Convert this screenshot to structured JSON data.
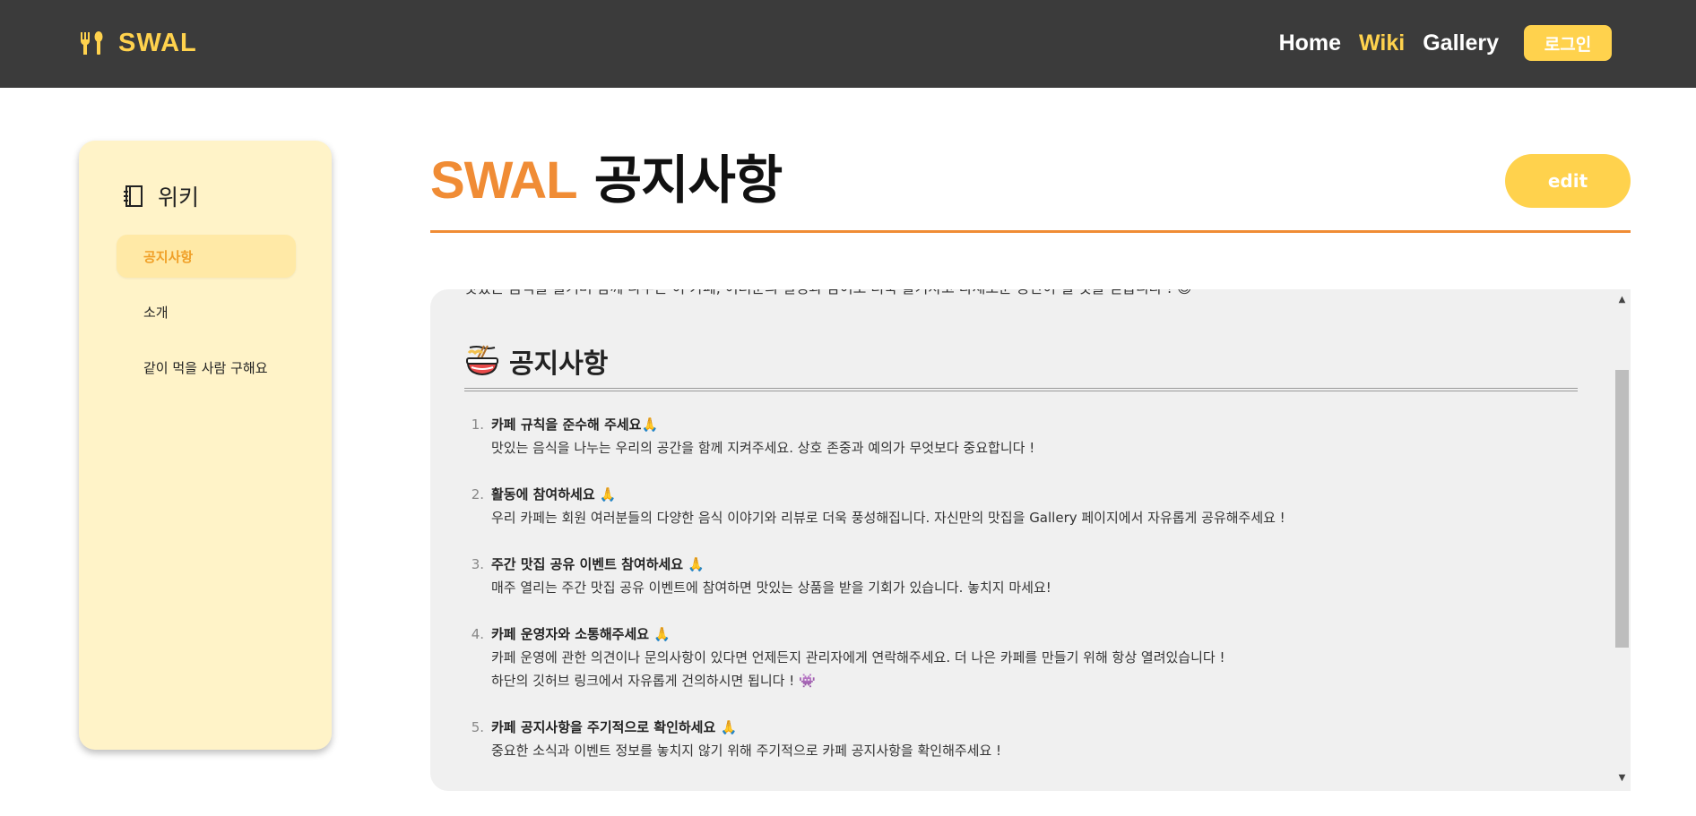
{
  "header": {
    "brand": "SWAL",
    "nav": [
      "Home",
      "Wiki",
      "Gallery"
    ],
    "login": "로그인",
    "accent_color": "#ffd24d"
  },
  "sidebar": {
    "title": "위키",
    "items": [
      "공지사항",
      "소개",
      "같이 먹을 사람 구해요"
    ],
    "active_item": "공지사항"
  },
  "page": {
    "title_brand": "SWAL",
    "title_rest": " 공지사항",
    "edit": "edit",
    "brand_color": "#f08c35"
  },
  "content": {
    "intro": "맛있는 음식을 즐기며 함께 나누는 이 카페, 여러분의 열정과 참여로 더욱 활기차고 다채로운 공간이 될 것을 믿습니다 ! 😊",
    "section_title": "공지사항",
    "notices": [
      {
        "num": "1.",
        "title": "카페 규칙을 준수해 주세요🙏",
        "desc": [
          "맛있는 음식을 나누는 우리의 공간을 함께 지켜주세요. 상호 존중과 예의가 무엇보다 중요합니다 !"
        ]
      },
      {
        "num": "2.",
        "title": "활동에 참여하세요 🙏",
        "desc": [
          "우리 카페는 회원 여러분들의 다양한 음식 이야기와 리뷰로 더욱 풍성해집니다. 자신만의 맛집을 Gallery 페이지에서 자유롭게 공유해주세요 !"
        ]
      },
      {
        "num": "3.",
        "title": "주간 맛집 공유 이벤트 참여하세요 🙏",
        "desc": [
          "매주 열리는 주간 맛집 공유 이벤트에 참여하면 맛있는 상품을 받을 기회가 있습니다. 놓치지 마세요!"
        ]
      },
      {
        "num": "4.",
        "title": "카페 운영자와 소통해주세요 🙏",
        "desc": [
          "카페 운영에 관한 의견이나 문의사항이 있다면 언제든지 관리자에게 연락해주세요. 더 나은 카페를 만들기 위해 항상 열려있습니다 !",
          "하단의 깃허브 링크에서 자유롭게 건의하시면 됩니다 ! 👾"
        ]
      },
      {
        "num": "5.",
        "title": "카페 공지사항을 주기적으로 확인하세요 🙏",
        "desc": [
          "중요한 소식과 이벤트 정보를 놓치지 않기 위해 주기적으로 카페 공지사항을 확인해주세요 !"
        ]
      }
    ]
  },
  "icons": {
    "logo": "fork-spoon-icon",
    "sidebar": "book-index-icon",
    "section": "noodle-bowl-icon"
  }
}
